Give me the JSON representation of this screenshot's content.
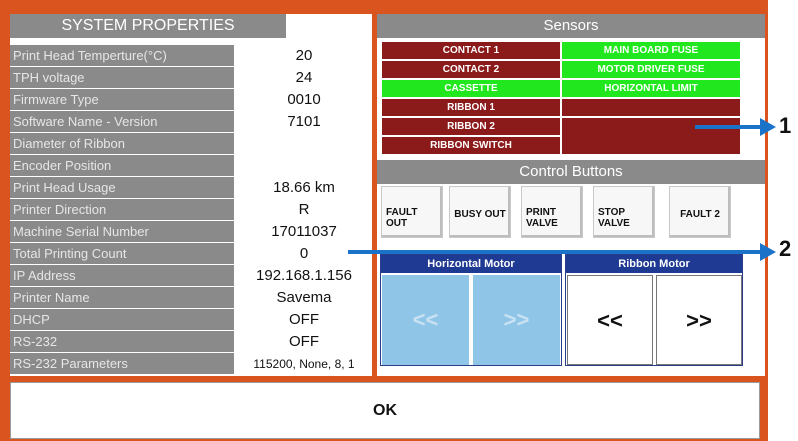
{
  "system_properties": {
    "title": "SYSTEM PROPERTIES",
    "rows": [
      {
        "label": "Print Head Temperture(°C)",
        "value": "20"
      },
      {
        "label": "TPH voltage",
        "value": "24"
      },
      {
        "label": "Firmware Type",
        "value": "0010"
      },
      {
        "label": "Software Name - Version",
        "value": "7101"
      },
      {
        "label": "Diameter of Ribbon",
        "value": ""
      },
      {
        "label": "Encoder Position",
        "value": ""
      },
      {
        "label": "Print Head Usage",
        "value": "18.66 km"
      },
      {
        "label": "Printer Direction",
        "value": "R"
      },
      {
        "label": "Machine Serial Number",
        "value": "17011037"
      },
      {
        "label": "Total Printing Count",
        "value": "0"
      },
      {
        "label": "IP Address",
        "value": "192.168.1.156"
      },
      {
        "label": "Printer Name",
        "value": "Savema"
      },
      {
        "label": "DHCP",
        "value": "OFF"
      },
      {
        "label": "RS-232",
        "value": "OFF"
      },
      {
        "label": "RS-232 Parameters",
        "value": "115200, None, 8, 1"
      }
    ]
  },
  "sensors": {
    "title": "Sensors",
    "items": [
      {
        "label": "CONTACT 1",
        "state": "red"
      },
      {
        "label": "MAIN BOARD FUSE",
        "state": "green"
      },
      {
        "label": "CONTACT 2",
        "state": "red"
      },
      {
        "label": "MOTOR DRIVER FUSE",
        "state": "green"
      },
      {
        "label": "CASSETTE",
        "state": "green"
      },
      {
        "label": "HORIZONTAL LIMIT",
        "state": "green"
      },
      {
        "label": "RIBBON 1",
        "state": "red"
      },
      {
        "label": "",
        "state": "red"
      },
      {
        "label": "RIBBON 2",
        "state": "red"
      },
      {
        "label": "",
        "state": "red"
      },
      {
        "label": "RIBBON SWITCH",
        "state": "red"
      }
    ]
  },
  "control_buttons": {
    "title": "Control Buttons",
    "buttons": [
      "FAULT\nOUT",
      "BUSY OUT",
      "PRINT\nVALVE",
      "STOP\nVALVE",
      "FAULT 2"
    ]
  },
  "horizontal_motor": {
    "title": "Horizontal Motor",
    "left": "<<",
    "right": ">>"
  },
  "ribbon_motor": {
    "title": "Ribbon Motor",
    "left": "<<",
    "right": ">>"
  },
  "ok_label": "OK",
  "callouts": [
    "1",
    "2"
  ],
  "colors": {
    "frame": "#d9541e",
    "sensor_red": "#8b1a1a",
    "sensor_green": "#21e81e",
    "motor_header": "#1f3a93",
    "callout": "#1a73c8"
  }
}
